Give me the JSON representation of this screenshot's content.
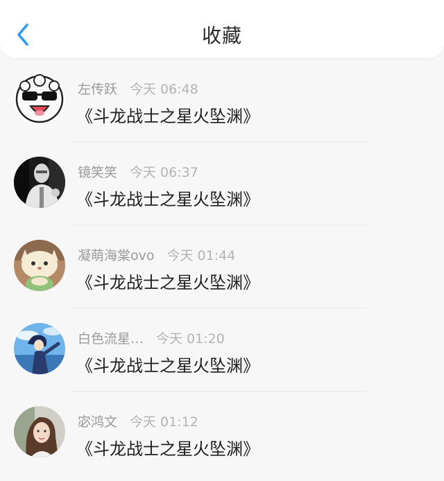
{
  "header": {
    "title": "收藏",
    "back_icon": "chevron-left-icon",
    "accent_color": "#2e9bf0"
  },
  "items": [
    {
      "user": "左传跃",
      "time": "今天 06:48",
      "book": "《斗龙战士之星火坠渊》",
      "avatar": "sheep-with-sunglasses-avatar"
    },
    {
      "user": "镜笑笑",
      "time": "今天 06:37",
      "book": "《斗龙战士之星火坠渊》",
      "avatar": "masked-figure-avatar"
    },
    {
      "user": "凝萌海棠ovo",
      "time": "今天 01:44",
      "book": "《斗龙战士之星火坠渊》",
      "avatar": "cat-plush-avatar"
    },
    {
      "user": "白色流星…",
      "time": "今天 01:20",
      "book": "《斗龙战士之星火坠渊》",
      "avatar": "anime-character-avatar"
    },
    {
      "user": "宓鸿文",
      "time": "今天 01:12",
      "book": "《斗龙战士之星火坠渊》",
      "avatar": "girl-photo-avatar"
    }
  ]
}
